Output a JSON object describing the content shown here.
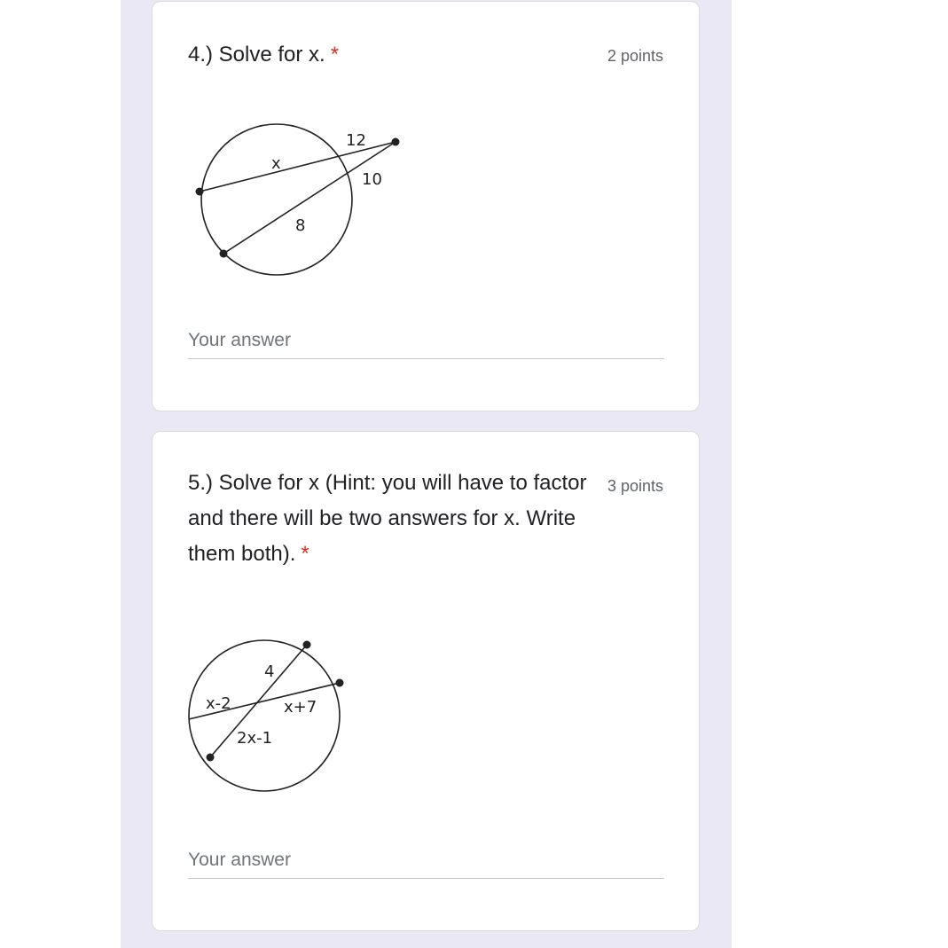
{
  "questions": [
    {
      "title": "4.) Solve for x.",
      "required_mark": "*",
      "points": "2 points",
      "figure_labels": {
        "a": "12",
        "b": "x",
        "c": "10",
        "d": "8"
      },
      "answer_placeholder": "Your answer"
    },
    {
      "title": "5.) Solve for x (Hint: you will have to factor and there will be two answers for x. Write them both).",
      "required_mark": "*",
      "points": "3 points",
      "figure_labels": {
        "a": "4",
        "b": "x-2",
        "c": "x+7",
        "d": "2x-1"
      },
      "answer_placeholder": "Your answer"
    }
  ],
  "colors": {
    "page_background": "#ebe8f5",
    "card_background": "#ffffff",
    "required": "#d93025",
    "muted_text": "#5f6368"
  }
}
